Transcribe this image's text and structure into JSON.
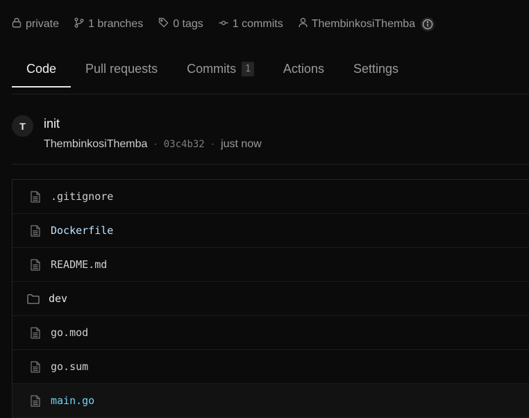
{
  "meta": {
    "visibility": "private",
    "branches": "1 branches",
    "tags": "0 tags",
    "commits": "1 commits",
    "owner": "ThembinkosiThemba",
    "icons": [
      "lock-icon",
      "branch-icon",
      "tag-icon",
      "commit-icon",
      "user-icon",
      "info-icon"
    ]
  },
  "tabs": [
    {
      "label": "Code",
      "active": true
    },
    {
      "label": "Pull requests",
      "active": false
    },
    {
      "label": "Commits",
      "count": "1",
      "active": false
    },
    {
      "label": "Actions",
      "active": false
    },
    {
      "label": "Settings",
      "active": false
    }
  ],
  "commit": {
    "avatar_initial": "T",
    "message": "init",
    "author": "ThembinkosiThemba",
    "separator": "·",
    "sha": "03c4b32",
    "time": "just now"
  },
  "files": [
    {
      "name": ".gitignore",
      "type": "file"
    },
    {
      "name": "Dockerfile",
      "type": "file"
    },
    {
      "name": "README.md",
      "type": "file"
    },
    {
      "name": "dev",
      "type": "folder"
    },
    {
      "name": "go.mod",
      "type": "file"
    },
    {
      "name": "go.sum",
      "type": "file"
    },
    {
      "name": "main.go",
      "type": "file"
    }
  ],
  "colors": {
    "background": "#0b0b0b",
    "muted_text": "#9a9a9a",
    "primary_text": "#f0f0f0",
    "dockerfile_name": "#bfe3ff",
    "go_file_name": "#74d2f3"
  }
}
